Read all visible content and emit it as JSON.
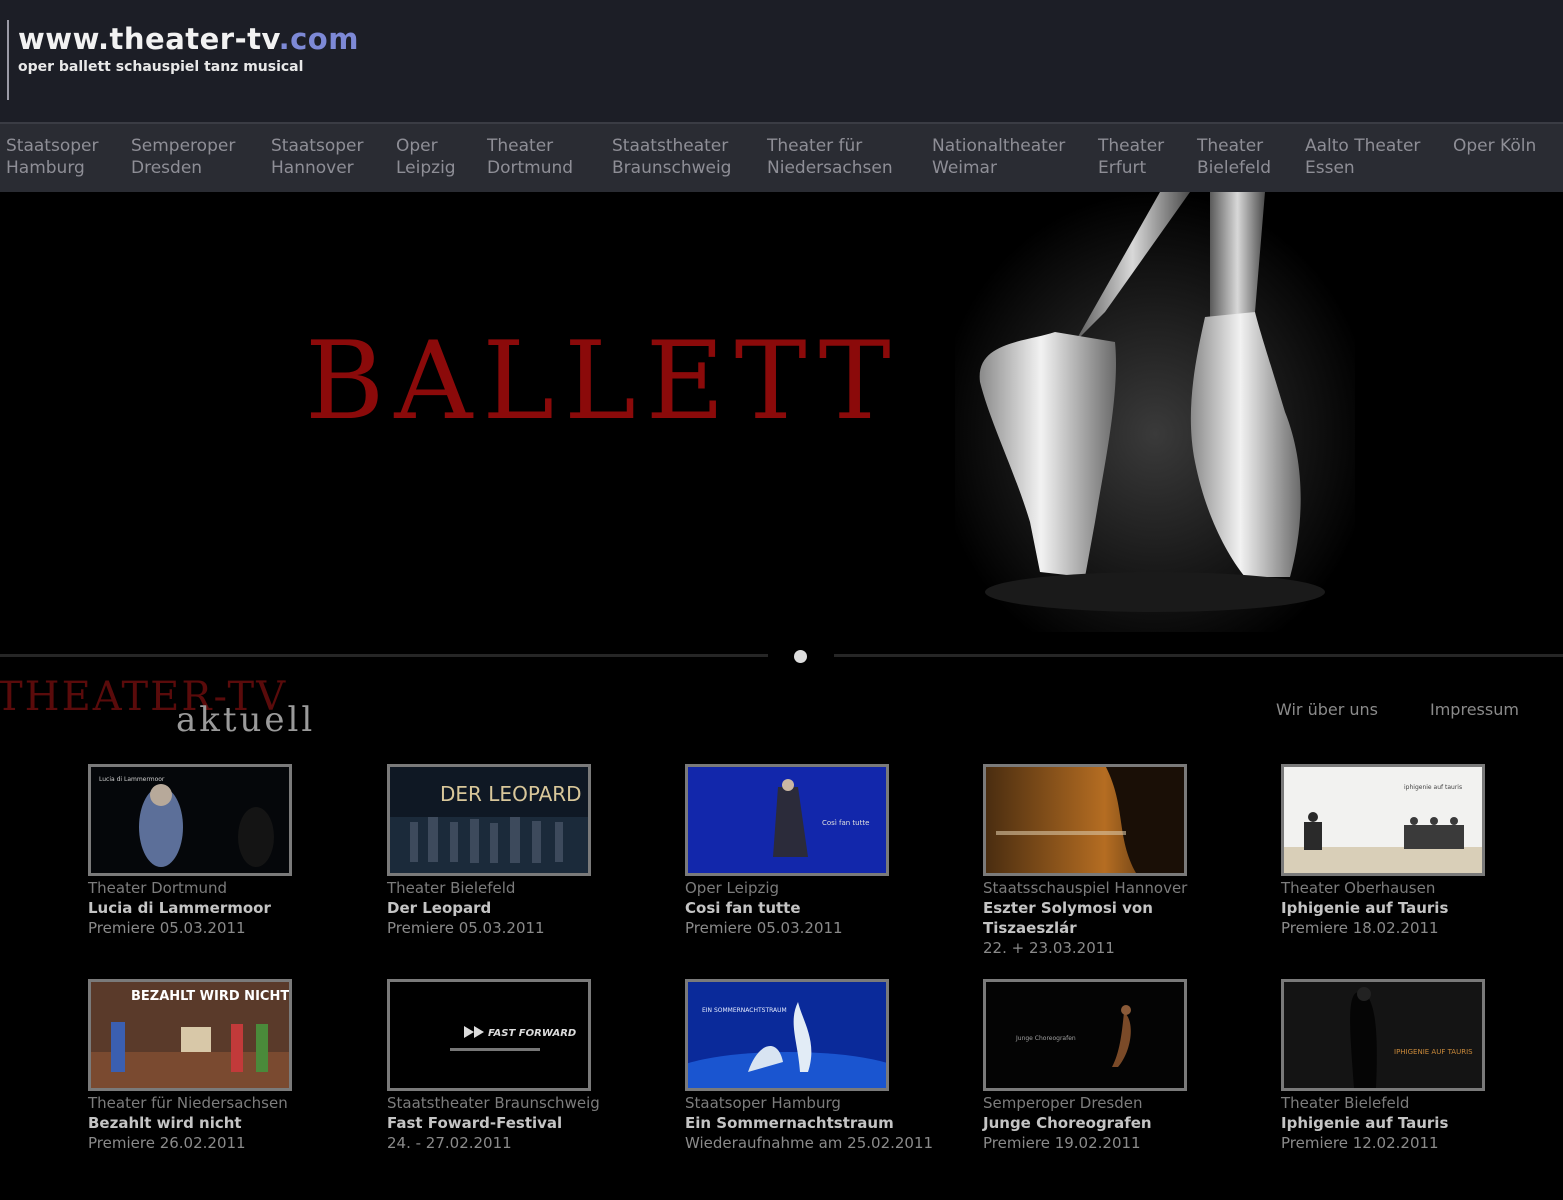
{
  "header": {
    "logo_main": "www.theater-tv",
    "logo_domain": ".com",
    "logo_sub": "oper ballett schauspiel tanz musical"
  },
  "nav": {
    "items": [
      {
        "line1": "Staatsoper",
        "line2": "Hamburg"
      },
      {
        "line1": "Semperoper",
        "line2": "Dresden"
      },
      {
        "line1": "Staatsoper",
        "line2": "Hannover"
      },
      {
        "line1": "Oper",
        "line2": "Leipzig"
      },
      {
        "line1": "Theater",
        "line2": "Dortmund"
      },
      {
        "line1": "Staatstheater",
        "line2": "Braunschweig"
      },
      {
        "line1": "Theater für",
        "line2": "Niedersachsen"
      },
      {
        "line1": "Nationaltheater",
        "line2": "Weimar"
      },
      {
        "line1": "Theater",
        "line2": "Erfurt"
      },
      {
        "line1": "Theater",
        "line2": "Bielefeld"
      },
      {
        "line1": "Aalto Theater",
        "line2": "Essen"
      },
      {
        "line1": "Oper Köln",
        "line2": ""
      }
    ]
  },
  "hero": {
    "title": "BALLETT"
  },
  "section": {
    "title_line1": "THEATER-TV",
    "title_line2": "aktuell",
    "links": [
      "Wir über uns",
      "Impressum"
    ]
  },
  "cards": [
    {
      "theater": "Theater Dortmund",
      "title": "Lucia di Lammermoor",
      "date": "Premiere 05.03.2011",
      "thumb_text": "Lucia di Lammermoor"
    },
    {
      "theater": "Theater Bielefeld",
      "title": "Der Leopard",
      "date": "Premiere 05.03.2011",
      "thumb_text": "DER LEOPARD"
    },
    {
      "theater": "Oper Leipzig",
      "title": "Cosi fan tutte",
      "date": "Premiere 05.03.2011",
      "thumb_text": "Così fan tutte"
    },
    {
      "theater": "Staatsschauspiel Hannover",
      "title": "Eszter Solymosi von Tiszaeszlár",
      "date": "22. + 23.03.2011",
      "thumb_text": ""
    },
    {
      "theater": "Theater Oberhausen",
      "title": "Iphigenie auf Tauris",
      "date": "Premiere 18.02.2011",
      "thumb_text": "iphigenie auf tauris"
    },
    {
      "theater": "Theater für Niedersachsen",
      "title": "Bezahlt wird nicht",
      "date": "Premiere 26.02.2011",
      "thumb_text": "BEZAHLT WIRD NICHT!"
    },
    {
      "theater": "Staatstheater Braunschweig",
      "title": "Fast Foward-Festival",
      "date": "24. - 27.02.2011",
      "thumb_text": "FAST FORWARD"
    },
    {
      "theater": "Staatsoper Hamburg",
      "title": "Ein Sommernachtstraum",
      "date": "Wiederaufnahme am 25.02.2011",
      "thumb_text": "EIN SOMMERNACHTSTRAUM"
    },
    {
      "theater": "Semperoper Dresden",
      "title": "Junge Choreografen",
      "date": "Premiere 19.02.2011",
      "thumb_text": "Junge Choreografen"
    },
    {
      "theater": "Theater Bielefeld",
      "title": "Iphigenie auf Tauris",
      "date": "Premiere 12.02.2011",
      "thumb_text": "IPHIGENIE AUF TAURIS"
    }
  ]
}
